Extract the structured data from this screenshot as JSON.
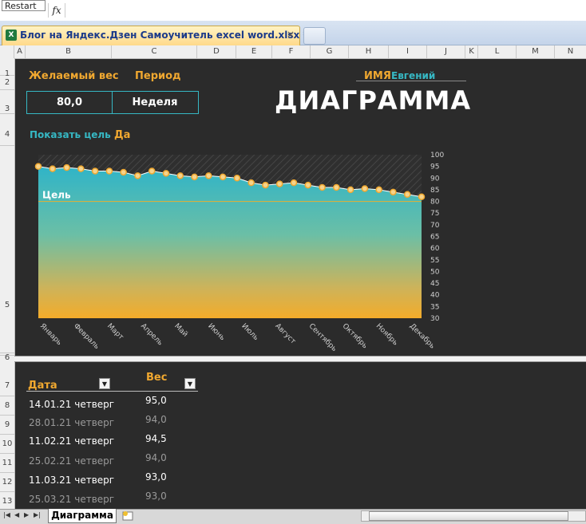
{
  "formula_bar": {
    "tooltip": "Restart",
    "fx": "fx"
  },
  "document_tab": {
    "title": "Блог на Яндекс.Дзен Самоучитель excel word.xlsx *",
    "close": "×"
  },
  "columns": [
    "A",
    "B",
    "C",
    "D",
    "E",
    "F",
    "G",
    "H",
    "I",
    "J",
    "K",
    "L",
    "M",
    "N"
  ],
  "rows": [
    "1",
    "2",
    "3",
    "4",
    "5",
    "6",
    "7",
    "8",
    "9",
    "10",
    "11",
    "12",
    "13"
  ],
  "labels": {
    "desired_weight": "Желаемый вес",
    "period": "Период",
    "name_label": "ИМЯ",
    "name_value": "Евгений",
    "show_goal": "Показать цель",
    "show_goal_value": "Да"
  },
  "inputs": {
    "desired_weight": "80,0",
    "period": "Неделя"
  },
  "title": "ДИАГРАММА",
  "chart_data": {
    "type": "area",
    "goal_label": "Цель",
    "goal": 80,
    "ylim": [
      30,
      100
    ],
    "yticks": [
      100,
      95,
      90,
      85,
      80,
      75,
      70,
      65,
      60,
      55,
      50,
      45,
      40,
      35,
      30
    ],
    "xlabels": [
      "Январь",
      "Февраль",
      "Март",
      "Апрель",
      "Май",
      "Июнь",
      "Июль",
      "Август",
      "Сентябрь",
      "Октябрь",
      "Ноябрь",
      "Декабрь"
    ],
    "values": [
      95.0,
      94.0,
      94.5,
      94.0,
      93.0,
      93.0,
      92.5,
      91.0,
      93.0,
      92.0,
      91.0,
      90.5,
      91.0,
      90.5,
      90.0,
      88.0,
      87.0,
      87.5,
      88.0,
      87.0,
      86.0,
      86.0,
      85.0,
      85.5,
      85.0,
      84.0,
      83.0,
      82.0
    ],
    "colors": {
      "top": "#2fb4c8",
      "bottom": "#f4ac2a",
      "marker": "#f0a830",
      "line": "#ffffff",
      "goal": "#e5b030"
    }
  },
  "table": {
    "headers": {
      "date": "Дата",
      "weight": "Вес"
    },
    "filter_glyph": "▼",
    "rows": [
      {
        "date": "14.01.21 четверг",
        "weight": "95,0"
      },
      {
        "date": "28.01.21 четверг",
        "weight": "94,0"
      },
      {
        "date": "11.02.21 четверг",
        "weight": "94,5"
      },
      {
        "date": "25.02.21 четверг",
        "weight": "94,0"
      },
      {
        "date": "11.03.21 четверг",
        "weight": "93,0"
      },
      {
        "date": "25.03.21 четверг",
        "weight": "93,0"
      }
    ]
  },
  "sheet_tabs": {
    "active": "Диаграмма"
  }
}
